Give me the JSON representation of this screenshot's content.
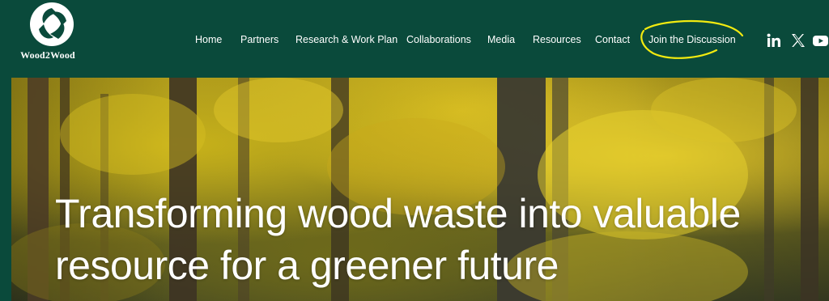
{
  "brand": {
    "name": "Wood2Wood",
    "logo_icon": "leaf-circle-icon"
  },
  "nav": {
    "items": [
      {
        "label": "Home"
      },
      {
        "label": "Partners"
      },
      {
        "label": "Research & Work Plan"
      },
      {
        "label": "Collaborations"
      },
      {
        "label": "Media"
      },
      {
        "label": "Resources"
      },
      {
        "label": "Contact"
      },
      {
        "label": "Join the Discussion"
      }
    ]
  },
  "social": [
    {
      "icon": "linkedin-icon",
      "label": "in"
    },
    {
      "icon": "x-icon",
      "label": "𝕏"
    },
    {
      "icon": "youtube-icon",
      "label": ""
    }
  ],
  "hero": {
    "title": "Transforming wood waste into valuable resource for a greener future"
  },
  "colors": {
    "header_bg": "#0a4a3b",
    "text": "#ffffff",
    "highlight": "#f2ea10"
  }
}
